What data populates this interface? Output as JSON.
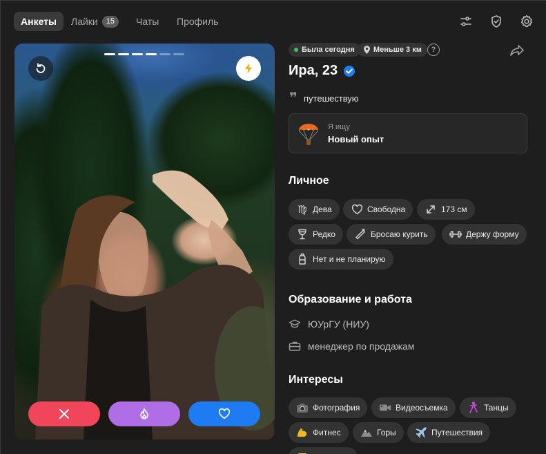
{
  "tabs": [
    {
      "label": "Анкеты",
      "active": true
    },
    {
      "label": "Лайки",
      "badge": "15"
    },
    {
      "label": "Чаты"
    },
    {
      "label": "Профиль"
    }
  ],
  "header_icons": [
    "sliders-icon",
    "shield-check-icon",
    "gear-icon"
  ],
  "photo": {
    "progress": {
      "total": 6,
      "current": 4
    },
    "undo_icon": "undo-icon",
    "boost_icon": "lightning-icon",
    "actions": [
      {
        "name": "dislike-button",
        "icon": "close-icon",
        "color": "#f0455a"
      },
      {
        "name": "super-like-button",
        "icon": "flame-icon",
        "color": "#b06ee6"
      },
      {
        "name": "like-button",
        "icon": "heart-icon",
        "color": "#1e7bf2"
      }
    ]
  },
  "profile": {
    "status": "Была сегодня",
    "distance": "Меньше 3 км",
    "name": "Ира, 23",
    "verified": true,
    "quote": "путешествую",
    "looking_for": {
      "label": "Я ищу",
      "value": "Новый опыт"
    }
  },
  "personal": {
    "title": "Личное",
    "chips": [
      "Дева",
      "Свободна",
      "173 см",
      "Редко",
      "Бросаю курить",
      "Держу форму",
      "Нет и не планирую"
    ]
  },
  "education": {
    "title": "Образование и работа",
    "school": "ЮУрГУ (НИУ)",
    "job": "менеджер по продажам"
  },
  "interests": {
    "title": "Интересы",
    "chips": [
      "Фотография",
      "Видеосъемка",
      "Танцы",
      "Фитнес",
      "Горы",
      "Путешествия"
    ]
  },
  "colors": {
    "background": "#1e1e1e",
    "chip": "#333333",
    "verified": "#1e7bf2",
    "online": "#31c75a"
  }
}
